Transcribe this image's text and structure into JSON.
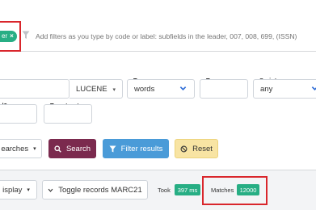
{
  "filter_bar": {
    "chip_label": "er",
    "chip_close": "×",
    "placeholder": "Add filters as you type by code or label: subfields in the leader, 007, 008, 699, (ISSN)"
  },
  "search_form": {
    "terms_label": "rms",
    "terms_value": "",
    "query_type_value": "LUCENE",
    "type_label": "Type",
    "type_value": "words",
    "tag_label": "Tag",
    "tag_value": "",
    "script_label": "Script",
    "script_value": "any",
    "ind2_label": "d2",
    "tag_structure_label": "Tag struct..."
  },
  "actions": {
    "saved_searches_label": "earches",
    "search_label": "Search",
    "filter_results_label": "Filter results",
    "reset_label": "Reset"
  },
  "results_bar": {
    "display_label": "isplay",
    "toggle_label": "Toggle records MARC21",
    "took_label": "Took",
    "took_value": "397 ms",
    "matches_label": "Matches",
    "matches_value": "12000"
  },
  "colors": {
    "accent_green": "#27ae84",
    "search_button": "#7b2a4e",
    "filter_button": "#4a9bd8",
    "reset_button": "#f8e4a3",
    "highlight_box": "#d9262c"
  }
}
